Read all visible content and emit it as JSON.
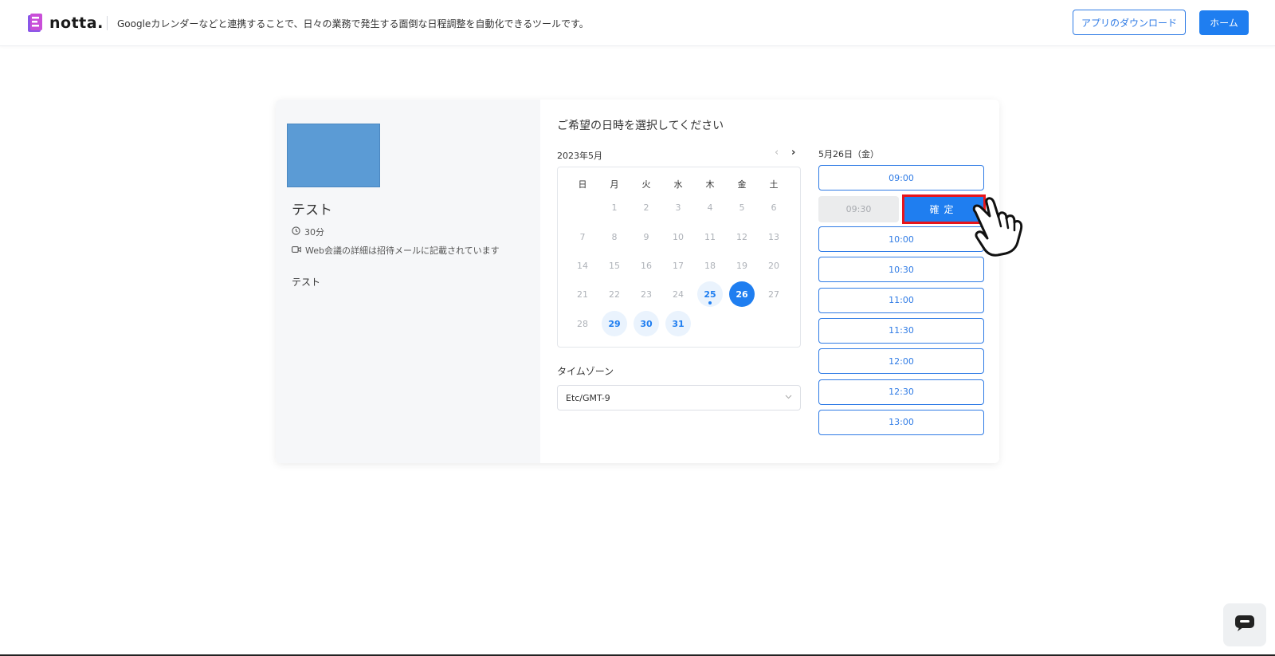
{
  "header": {
    "logo_text": "notta.",
    "tagline": "Googleカレンダーなどと連携することで、日々の業務で発生する面倒な日程調整を自動化できるツールです。",
    "download_label": "アプリのダウンロード",
    "home_label": "ホーム"
  },
  "event": {
    "title": "テスト",
    "duration": "30分",
    "meeting_note": "Web会議の詳細は招待メールに記載されています",
    "description": "テスト"
  },
  "scheduler": {
    "heading": "ご希望の日時を選択してください",
    "month": "2023年5月",
    "prev_icon": "‹",
    "next_icon": "›",
    "weekdays": [
      "日",
      "月",
      "火",
      "水",
      "木",
      "金",
      "土"
    ],
    "weeks": [
      [
        "",
        "1",
        "2",
        "3",
        "4",
        "5",
        "6"
      ],
      [
        "7",
        "8",
        "9",
        "10",
        "11",
        "12",
        "13"
      ],
      [
        "14",
        "15",
        "16",
        "17",
        "18",
        "19",
        "20"
      ],
      [
        "21",
        "22",
        "23",
        "24",
        "25",
        "26",
        "27"
      ],
      [
        "28",
        "29",
        "30",
        "31",
        "",
        "",
        ""
      ]
    ],
    "available_days": [
      "25",
      "26",
      "29",
      "30",
      "31"
    ],
    "today": "25",
    "selected_day": "26",
    "timezone_label": "タイムゾーン",
    "timezone_value": "Etc/GMT-9"
  },
  "slots": {
    "date_heading": "5月26日（金）",
    "first": "09:00",
    "selected": "09:30",
    "confirm_label": "確定",
    "rest": [
      "10:00",
      "10:30",
      "11:00",
      "11:30",
      "12:00",
      "12:30",
      "13:00"
    ]
  },
  "colors": {
    "accent": "#1f7ef0",
    "highlight_border": "#e8151b",
    "left_pane_bg": "#f6f7f9",
    "thumbnail": "#5b9bd5"
  },
  "icons": {
    "clock": "clock-icon",
    "video": "video-icon",
    "chevron": "chevron-down-icon",
    "chat": "chat-icon",
    "pointer": "pointing-hand-icon"
  }
}
